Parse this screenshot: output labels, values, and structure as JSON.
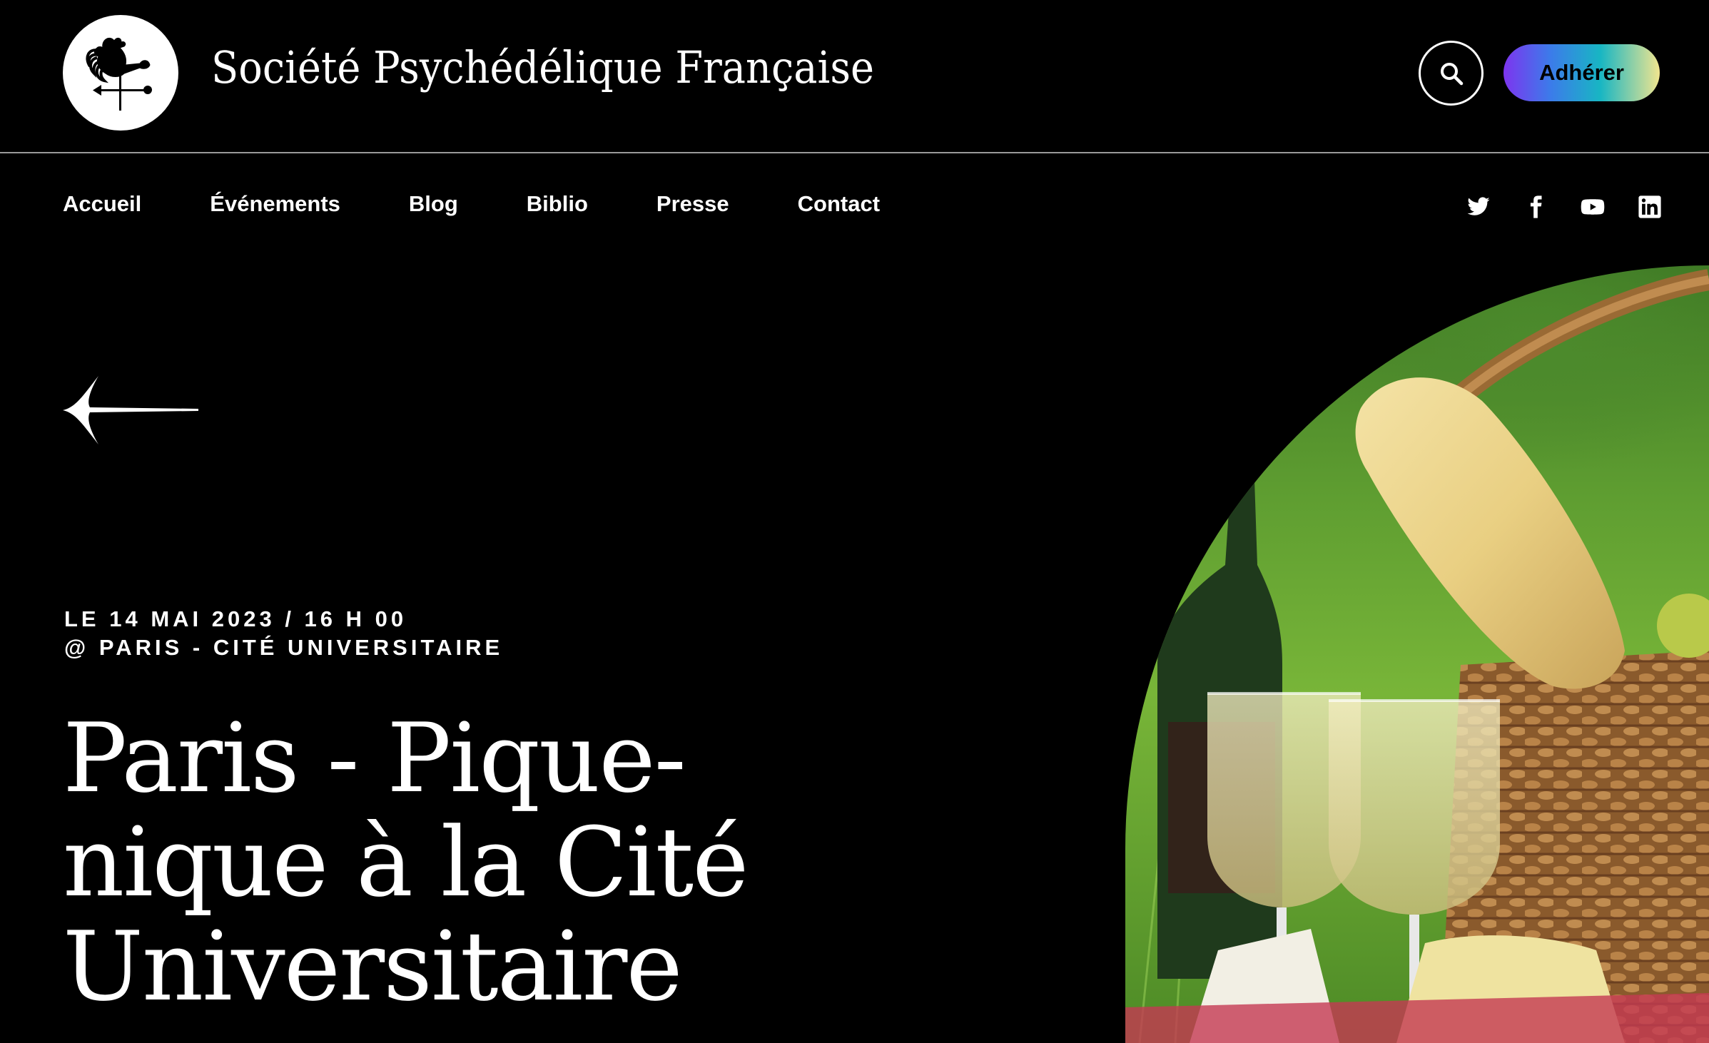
{
  "header": {
    "site_title": "Société Psychédélique Française",
    "logo_icon": "rooster-weathervane-icon",
    "search_icon": "search-icon",
    "join_label": "Adhérer",
    "join_gradient": [
      "#7d35ef",
      "#3c7bea",
      "#18b6c3",
      "#f1e58f"
    ]
  },
  "nav": {
    "items": [
      {
        "label": "Accueil"
      },
      {
        "label": "Événements"
      },
      {
        "label": "Blog"
      },
      {
        "label": "Biblio"
      },
      {
        "label": "Presse"
      },
      {
        "label": "Contact"
      }
    ]
  },
  "social": {
    "icons": [
      "twitter-icon",
      "facebook-icon",
      "youtube-icon",
      "linkedin-icon"
    ]
  },
  "event": {
    "back_icon": "back-arrow-icon",
    "date_line": "LE 14 MAI 2023 / 16 H 00",
    "location_line": "@ PARIS - CITÉ UNIVERSITAIRE",
    "title": "Paris - Pique-nique à la Cité Universitaire",
    "image_subject": "picnic-basket-wine-bread-photo"
  },
  "colors": {
    "background": "#000000",
    "text": "#ffffff",
    "rule": "#9a9a9a"
  }
}
